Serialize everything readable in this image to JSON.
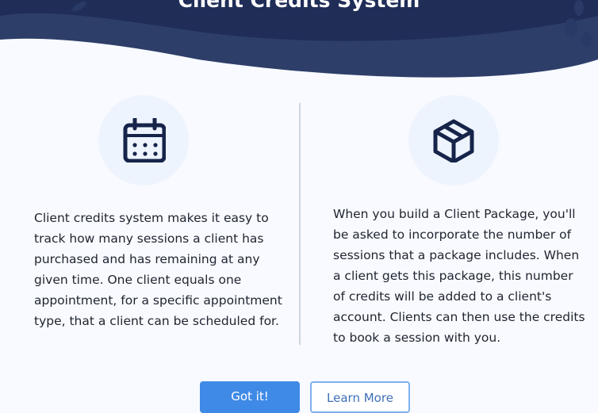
{
  "header": {
    "title": "Client Credits System"
  },
  "features": [
    {
      "icon": "calendar-icon",
      "text": "Client credits system makes it easy to track how many sessions a client has purchased and has remaining at any given time. One client equals one appointment, for a specific appointment type, that a client can be scheduled for."
    },
    {
      "icon": "package-icon",
      "text": "When you build a Client Package, you'll be asked to incorporate the number of sessions that a package includes. When a client gets this package, this number of credits will be added to a client's account. Clients can then use the credits to book a session with you."
    }
  ],
  "buttons": {
    "primary": "Got it!",
    "secondary": "Learn More"
  },
  "colors": {
    "header": "#1f2d57",
    "accent": "#3f8ae6",
    "icon": "#16244a"
  }
}
